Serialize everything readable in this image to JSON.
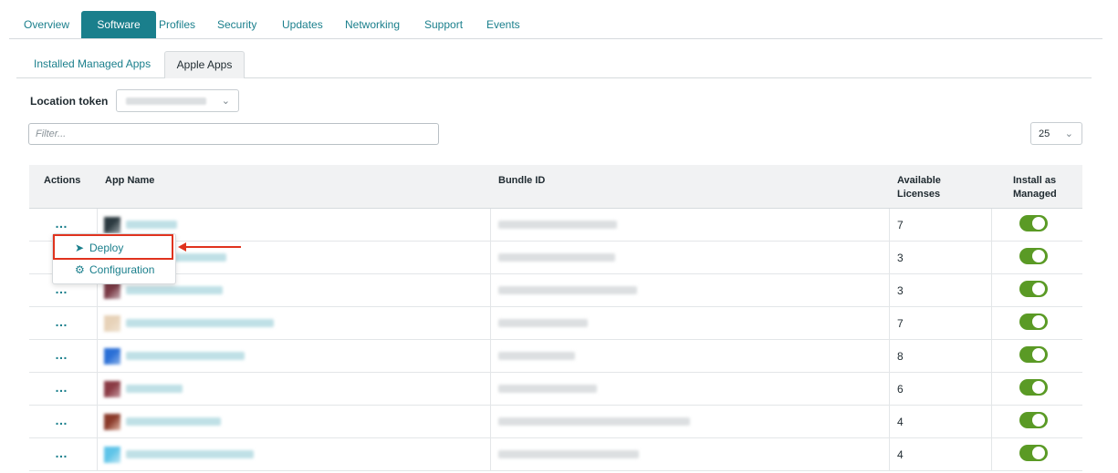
{
  "top_tabs": [
    "Overview",
    "Software",
    "Profiles",
    "Security",
    "Updates",
    "Networking",
    "Support",
    "Events"
  ],
  "sub_tabs": [
    "Installed Managed Apps",
    "Apple Apps"
  ],
  "location_token": {
    "label": "Location token"
  },
  "filter": {
    "placeholder": "Filter..."
  },
  "page_size": {
    "value": "25"
  },
  "table": {
    "headers": {
      "actions": "Actions",
      "app_name": "App Name",
      "bundle_id": "Bundle ID",
      "available_licenses": "Available Licenses",
      "install_as_managed": "Install as Managed"
    },
    "rows": [
      {
        "licenses": "7",
        "install_as_managed": true
      },
      {
        "licenses": "3",
        "install_as_managed": true
      },
      {
        "licenses": "3",
        "install_as_managed": true
      },
      {
        "licenses": "7",
        "install_as_managed": true
      },
      {
        "licenses": "8",
        "install_as_managed": true
      },
      {
        "licenses": "6",
        "install_as_managed": true
      },
      {
        "licenses": "4",
        "install_as_managed": true
      },
      {
        "licenses": "4",
        "install_as_managed": true
      }
    ]
  },
  "actions_menu": {
    "items": [
      {
        "label": "Deploy",
        "icon": "rocket-icon"
      },
      {
        "label": "Configuration",
        "icon": "gear-icon"
      }
    ]
  },
  "colors": {
    "accent": "#1a7f8c",
    "toggle_on": "#5a9a25",
    "annotation": "#e0331e"
  }
}
